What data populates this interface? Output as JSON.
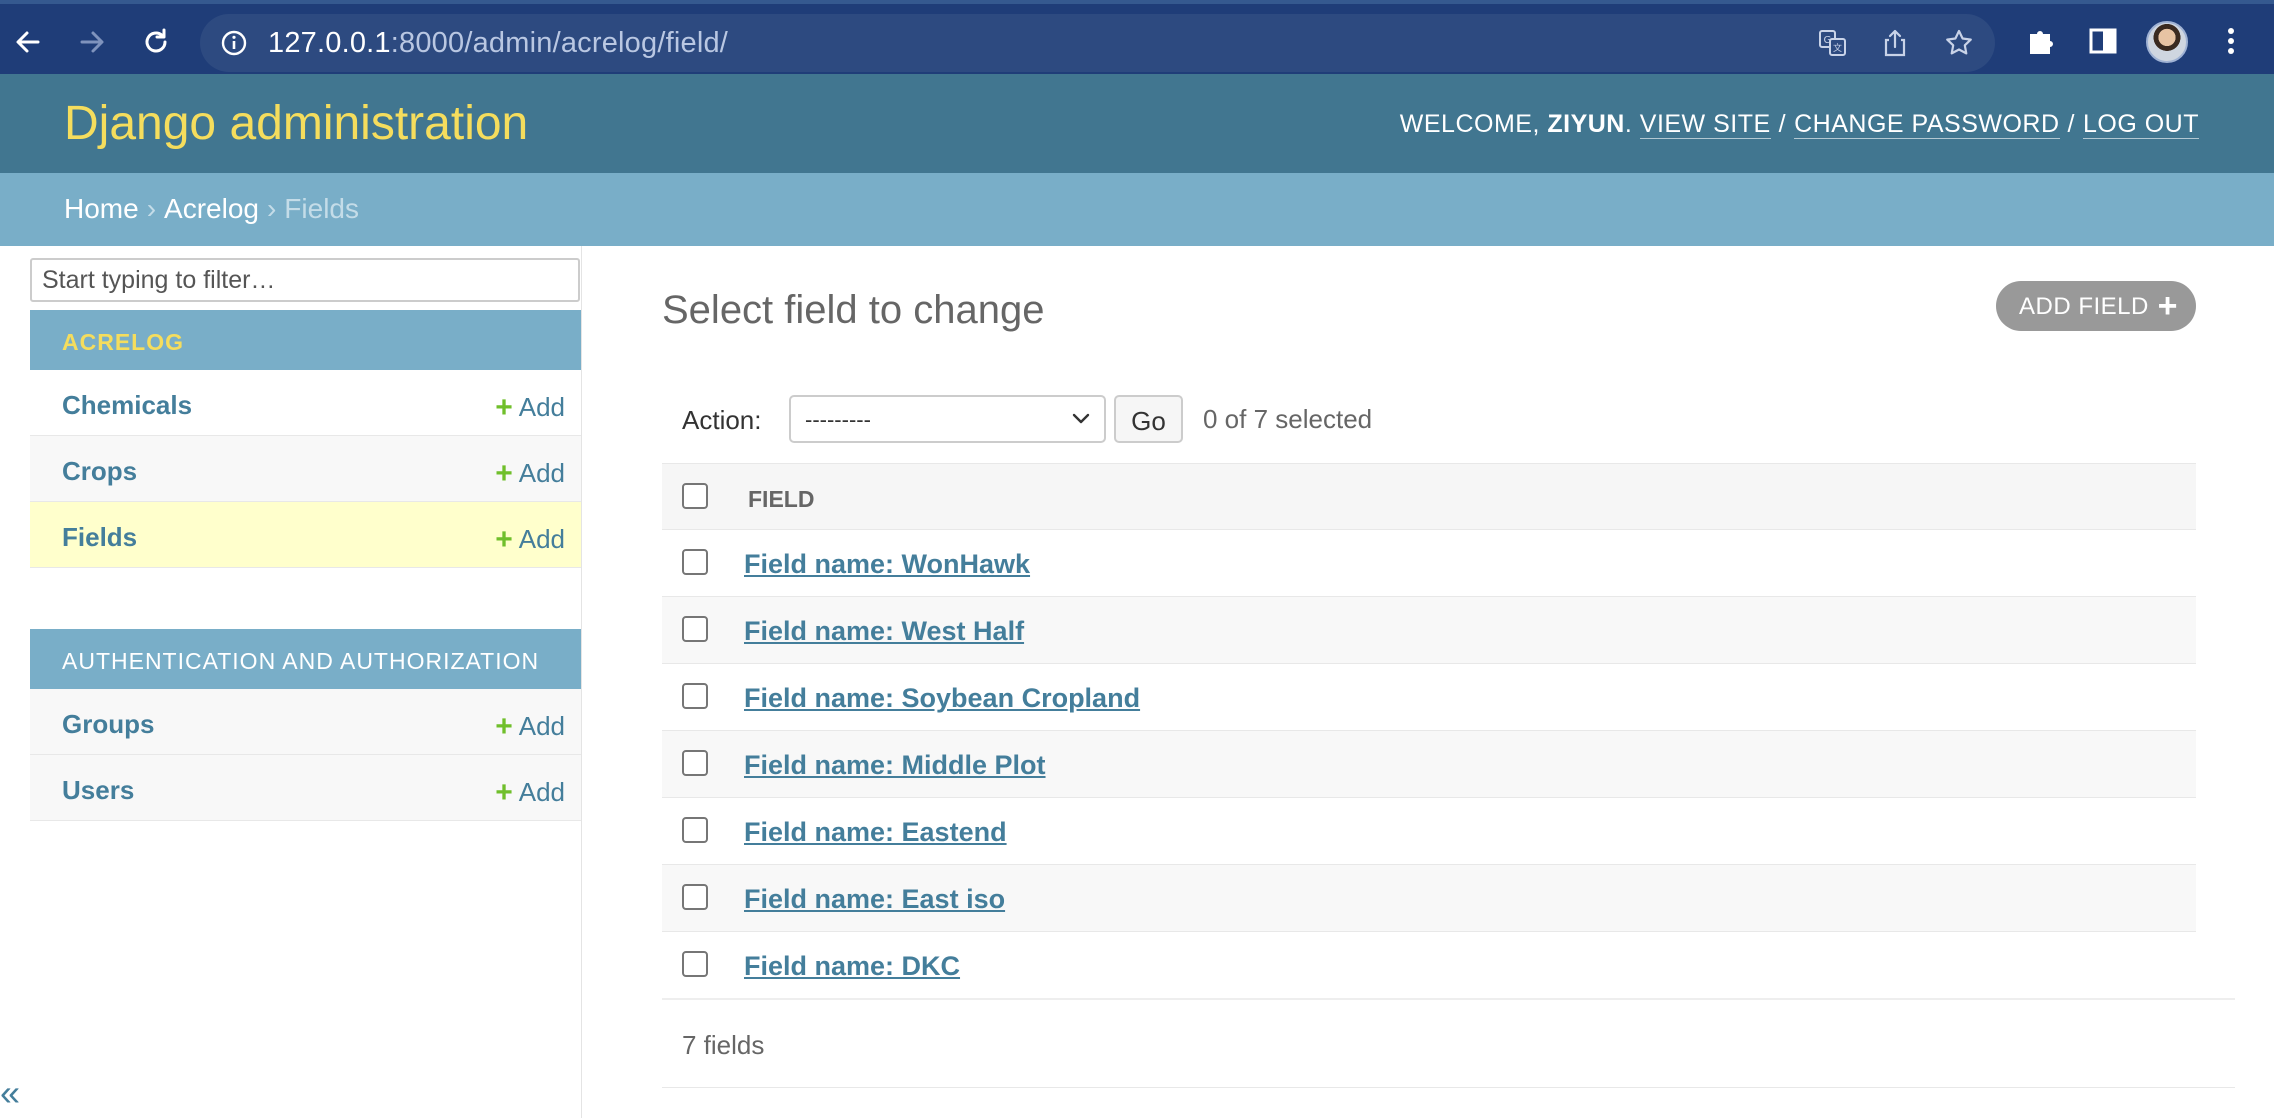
{
  "browser": {
    "url_host": "127.0.0.1",
    "url_path": ":8000/admin/acrelog/field/"
  },
  "header": {
    "branding": "Django administration",
    "welcome": "WELCOME, ",
    "username": "ZIYUN",
    "view_site": "VIEW SITE",
    "change_password": "CHANGE PASSWORD",
    "log_out": "LOG OUT"
  },
  "breadcrumbs": {
    "home": "Home",
    "app": "Acrelog",
    "current": "Fields"
  },
  "sidebar": {
    "filter_placeholder": "Start typing to filter…",
    "acrelog_caption": "ACRELOG",
    "acrelog_models": [
      {
        "name": "Chemicals",
        "add": "Add"
      },
      {
        "name": "Crops",
        "add": "Add"
      },
      {
        "name": "Fields",
        "add": "Add"
      }
    ],
    "auth_caption": "AUTHENTICATION AND AUTHORIZATION",
    "auth_models": [
      {
        "name": "Groups",
        "add": "Add"
      },
      {
        "name": "Users",
        "add": "Add"
      }
    ],
    "collapse_glyph": "«"
  },
  "content": {
    "title": "Select field to change",
    "add_button": "ADD FIELD",
    "action_label": "Action:",
    "action_selected": "---------",
    "go_label": "Go",
    "selected_count": "0 of 7 selected",
    "column_header": "FIELD",
    "rows": [
      "Field name: WonHawk",
      "Field name: West Half",
      "Field name: Soybean Cropland",
      "Field name: Middle Plot",
      "Field name: Eastend",
      "Field name: East iso",
      "Field name: DKC"
    ],
    "paginator": "7 fields"
  },
  "colors": {
    "header_bg": "#417690",
    "breadcrumb_bg": "#79aec8",
    "branding": "#f5dd5d",
    "link": "#447e9b",
    "add_green": "#70bf2b",
    "current_row": "#ffffcc"
  }
}
